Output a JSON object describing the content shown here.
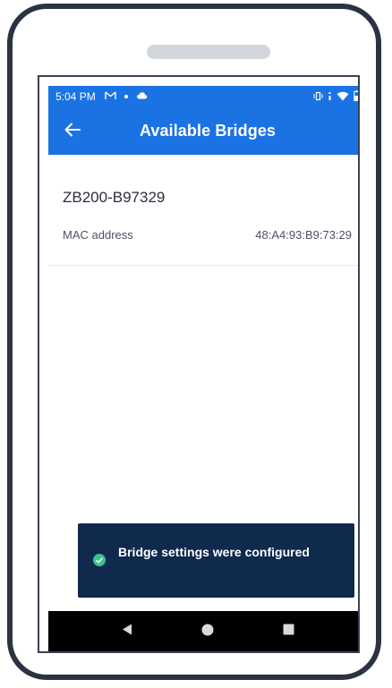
{
  "status_bar": {
    "time": "5:04 PM",
    "left_icons": [
      "gmail-icon",
      "dot-icon",
      "cloud-icon"
    ],
    "right_icons": [
      "vibrate-icon",
      "signal-icon",
      "wifi-icon",
      "battery-icon"
    ]
  },
  "app_bar": {
    "title": "Available Bridges",
    "back_icon": "arrow-left-icon"
  },
  "bridges": [
    {
      "name": "ZB200-B97329",
      "mac_label": "MAC address",
      "mac_value": "48:A4:93:B9:73:29"
    }
  ],
  "snackbar": {
    "icon": "check-circle-icon",
    "message": "Bridge settings were configured"
  },
  "nav_bar": {
    "buttons": [
      "back-triangle-icon",
      "home-circle-icon",
      "recents-square-icon"
    ]
  },
  "colors": {
    "primary": "#1b73e3",
    "snackbar_bg": "#0f2a4d",
    "success": "#3ec28f",
    "frame": "#2b3342"
  }
}
